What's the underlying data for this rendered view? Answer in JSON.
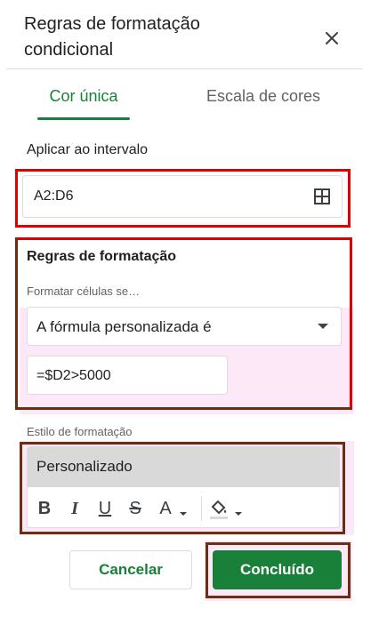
{
  "panel": {
    "title": "Regras de formatação condicional"
  },
  "tabs": [
    {
      "label": "Cor única",
      "active": true
    },
    {
      "label": "Escala de cores",
      "active": false
    }
  ],
  "range": {
    "label": "Aplicar ao intervalo",
    "value": "A2:D6"
  },
  "rules": {
    "heading": "Regras de formatação",
    "condition_label": "Formatar células se…",
    "condition_value": "A fórmula personalizada é",
    "formula_value": "=$D2>5000"
  },
  "style": {
    "label": "Estilo de formatação",
    "preset": "Personalizado",
    "text_color_glyph": "A"
  },
  "buttons": {
    "cancel": "Cancelar",
    "done": "Concluído"
  },
  "colors": {
    "accent_green": "#188038",
    "highlight_red": "#e00000",
    "highlight_brown": "#6b2f0f",
    "highlight_pink": "#fce8f6"
  }
}
